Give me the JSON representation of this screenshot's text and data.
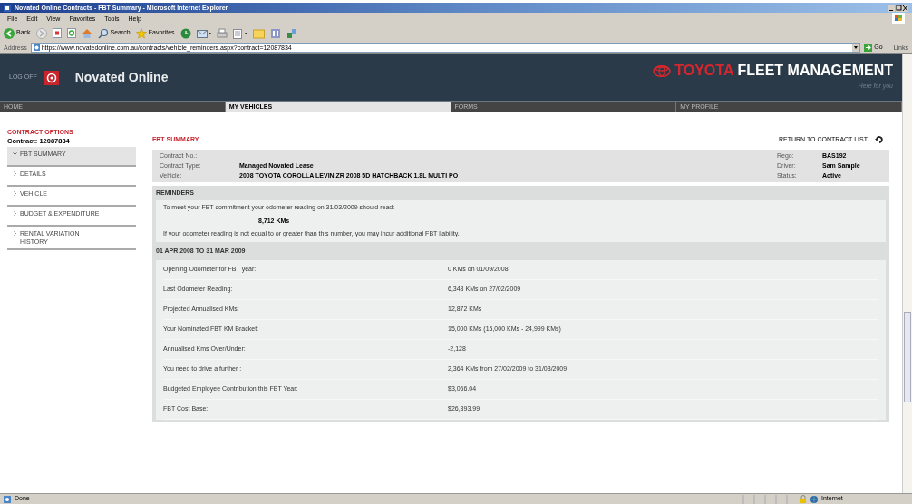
{
  "window": {
    "title": "Novated Online Contracts - FBT Summary - Microsoft Internet Explorer"
  },
  "menu": [
    "File",
    "Edit",
    "View",
    "Favorites",
    "Tools",
    "Help"
  ],
  "toolbar": {
    "back": "Back",
    "search": "Search",
    "favorites": "Favorites"
  },
  "address": {
    "label": "Address",
    "url": "https://www.novatedonline.com.au/contracts/vehicle_reminders.aspx?contract=12087834",
    "go": "Go",
    "links": "Links"
  },
  "header": {
    "log_off": "LOG OFF",
    "site": "Novated Online",
    "brand": "TOYOTA",
    "brand_rest": "FLEET MANAGEMENT",
    "tagline": "Here for you"
  },
  "nav": [
    {
      "label": "HOME",
      "selected": false
    },
    {
      "label": "MY VEHICLES",
      "selected": true
    },
    {
      "label": "FORMS",
      "selected": false
    },
    {
      "label": "MY PROFILE",
      "selected": false
    }
  ],
  "sidebar": {
    "heading": "CONTRACT OPTIONS",
    "contract": "Contract: 12087834",
    "items": [
      {
        "label": "FBT SUMMARY",
        "selected": true
      },
      {
        "label": "DETAILS",
        "selected": false
      },
      {
        "label": "VEHICLE",
        "selected": false
      },
      {
        "label": "BUDGET & EXPENDITURE",
        "selected": false
      },
      {
        "label": "RENTAL VARIATION HISTORY",
        "selected": false
      }
    ]
  },
  "page_title": "FBT SUMMARY",
  "return_link": "RETURN TO CONTRACT LIST",
  "summary": [
    {
      "label": "Contract No.:",
      "label2": "Rego:",
      "value2": "BAS192"
    },
    {
      "label": "Contract Type:",
      "value": "Managed Novated Lease",
      "label2": "Driver:",
      "value2": "Sam Sample"
    },
    {
      "label": "Vehicle:",
      "value": "2008 TOYOTA COROLLA LEVIN ZR 2008 5D HATCHBACK 1.8L MULTI PO",
      "label2": "Status:",
      "value2": "Active"
    }
  ],
  "reminders": {
    "heading": "REMINDERS",
    "line1": "To meet your FBT commitment your odometer reading on 31/03/2009 should read:",
    "target": "8,712 KMs",
    "line2": "If your odometer reading is not equal to or greater than this number, you may incur additional FBT liability."
  },
  "period": {
    "heading": "01 APR 2008 TO 31 MAR 2009",
    "rows": [
      {
        "label": "Opening Odometer for FBT year:",
        "value": "0 KMs on 01/09/2008"
      },
      {
        "label": "Last Odometer Reading:",
        "value": "6,348 KMs on 27/02/2009"
      },
      {
        "label": "Projected Annualised KMs:",
        "value": "12,872 KMs"
      },
      {
        "label": "Your Nominated FBT KM Bracket:",
        "value": "15,000 KMs (15,000 KMs - 24,999 KMs)"
      },
      {
        "label": "Annualised Kms Over/Under:",
        "value": "-2,128"
      },
      {
        "label": "You need to drive a further :",
        "value": "2,364 KMs from 27/02/2009 to 31/03/2009"
      },
      {
        "label": "Budgeted Employee Contribution this FBT Year:",
        "value": "$3,066.04"
      },
      {
        "label": "FBT Cost Base:",
        "value": "$26,393.99"
      }
    ]
  },
  "status_bar": {
    "text": "Done",
    "zone": "Internet"
  }
}
